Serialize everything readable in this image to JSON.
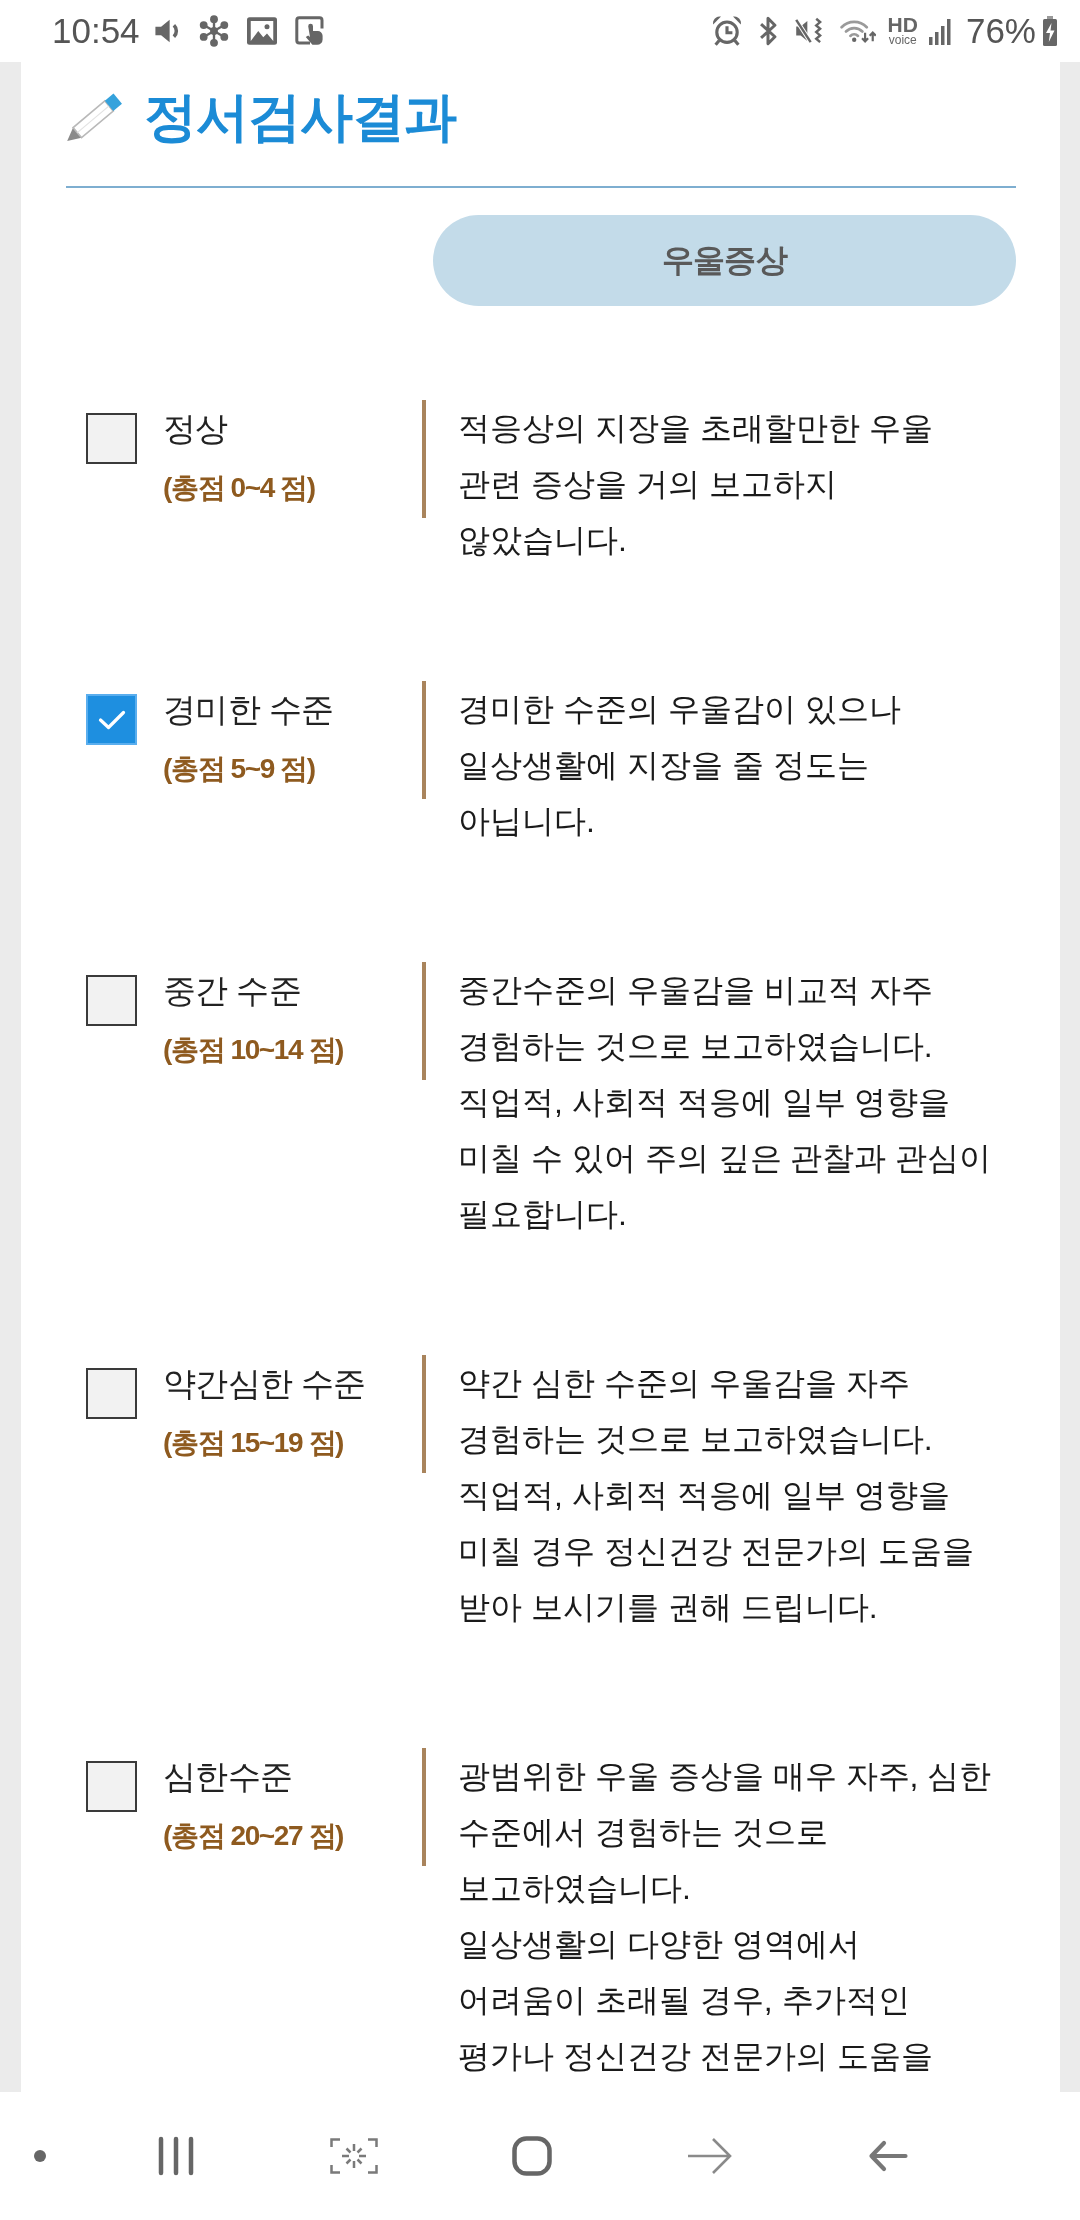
{
  "status_bar": {
    "time": "10:54",
    "hd_label": "HD",
    "voice_label": "voice",
    "battery": "76%"
  },
  "header": {
    "title": "정서검사결과",
    "category": "우울증상"
  },
  "levels": [
    {
      "label": "정상",
      "score": "(총점 0~4 점)",
      "checked": false,
      "description": "적응상의 지장을 초래할만한 우울 관련 증상을 거의 보고하지 않았습니다."
    },
    {
      "label": "경미한 수준",
      "score": "(총점 5~9 점)",
      "checked": true,
      "description": "경미한 수준의 우울감이 있으나 일상생활에 지장을 줄 정도는 아닙니다."
    },
    {
      "label": "중간 수준",
      "score": "(총점 10~14 점)",
      "checked": false,
      "description": "중간수준의 우울감을 비교적 자주 경험하는 것으로 보고하였습니다. 직업적, 사회적 적응에 일부 영향을 미칠 수 있어 주의 깊은 관찰과 관심이 필요합니다."
    },
    {
      "label": "약간심한 수준",
      "score": "(총점 15~19 점)",
      "checked": false,
      "description": "약간 심한 수준의 우울감을 자주 경험하는 것으로 보고하였습니다. 직업적, 사회적 적응에 일부 영향을 미칠 경우 정신건강 전문가의 도움을 받아 보시기를 권해 드립니다."
    },
    {
      "label": "심한수준",
      "score": "(총점 20~27 점)",
      "checked": false,
      "description": "광범위한 우울 증상을 매우 자주, 심한 수준에서 경험하는 것으로 보고하였습니다.\n일상생활의 다양한 영역에서 어려움이 초래될 경우, 추가적인 평가나 정신건강 전문가의 도움을"
    }
  ]
}
